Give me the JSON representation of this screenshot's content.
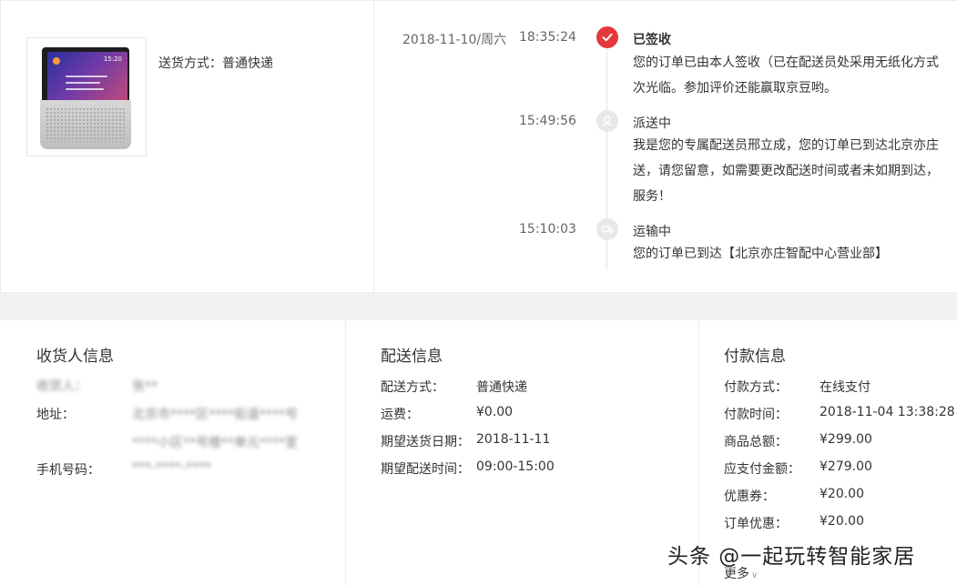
{
  "shipment": {
    "delivery_method_line": "送货方式：普通快递",
    "product_screen_clock": "15:20"
  },
  "tracking": {
    "date": "2018-11-10/周六",
    "events": [
      {
        "time": "18:35:24",
        "status": "已签收",
        "icon": "check-icon",
        "lines": [
          "您的订单已由本人签收（已在配送员处采用无纸化方式",
          "次光临。参加评价还能赢取京豆哟。"
        ]
      },
      {
        "time": "15:49:56",
        "status": "派送中",
        "icon": "courier-icon",
        "lines": [
          "我是您的专属配送员邢立成，您的订单已到达北京亦庄",
          "送，请您留意，如需要更改配送时间或者未如期到达，",
          "服务！"
        ]
      },
      {
        "time": "15:10:03",
        "status": "运输中",
        "icon": "truck-icon",
        "lines": [
          "您的订单已到达【北京亦庄智配中心营业部】"
        ]
      }
    ]
  },
  "consignee": {
    "title": "收货人信息",
    "name_label": "收货人：",
    "name_value": "张**",
    "address_label": "地址：",
    "address_line1": "北京市****区****街道****号",
    "address_line2": "****小区**号楼**单元****室",
    "phone_label": "手机号码：",
    "phone_value": "***-****-****"
  },
  "delivery": {
    "title": "配送信息",
    "rows": [
      {
        "label": "配送方式：",
        "value": "普通快递"
      },
      {
        "label": "运费：",
        "value": "¥0.00"
      },
      {
        "label": "期望送货日期：",
        "value": "2018-11-11"
      },
      {
        "label": "期望配送时间：",
        "value": "09:00-15:00"
      }
    ]
  },
  "payment": {
    "title": "付款信息",
    "rows": [
      {
        "label": "付款方式：",
        "value": "在线支付"
      },
      {
        "label": "付款时间：",
        "value": "2018-11-04 13:38:28"
      },
      {
        "label": "商品总额：",
        "value": "¥299.00"
      },
      {
        "label": "应支付金额：",
        "value": "¥279.00"
      },
      {
        "label": "优惠券：",
        "value": "¥20.00"
      },
      {
        "label": "订单优惠：",
        "value": "¥20.00"
      }
    ],
    "more_label": "更多"
  },
  "watermark": "头条 @一起玩转智能家居",
  "colors": {
    "accent_red": "#e4393c",
    "divider": "#ececec",
    "gap_gray": "#f2f2f2"
  }
}
